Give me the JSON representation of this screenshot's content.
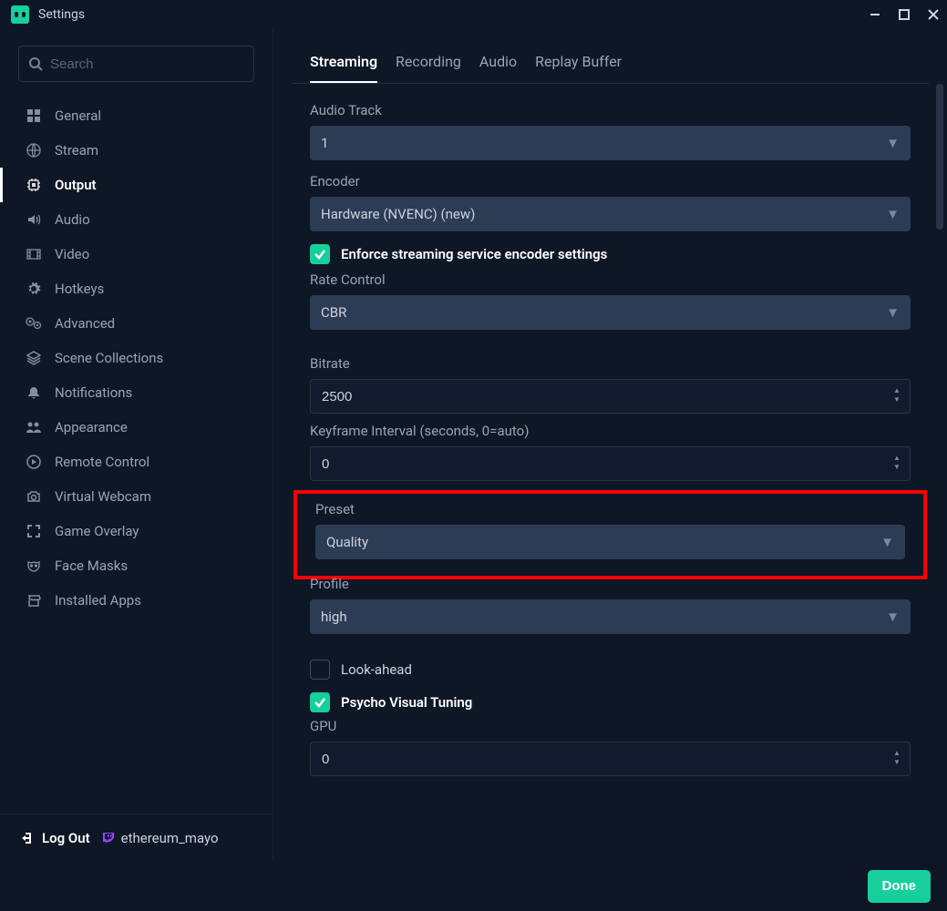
{
  "window": {
    "title": "Settings"
  },
  "search": {
    "placeholder": "Search"
  },
  "sidebar": {
    "items": [
      {
        "label": "General",
        "icon": "grid-icon"
      },
      {
        "label": "Stream",
        "icon": "globe-icon"
      },
      {
        "label": "Output",
        "icon": "chip-icon",
        "active": true
      },
      {
        "label": "Audio",
        "icon": "volume-icon"
      },
      {
        "label": "Video",
        "icon": "film-icon"
      },
      {
        "label": "Hotkeys",
        "icon": "gear-icon"
      },
      {
        "label": "Advanced",
        "icon": "gears-icon"
      },
      {
        "label": "Scene Collections",
        "icon": "layers-icon"
      },
      {
        "label": "Notifications",
        "icon": "bell-icon"
      },
      {
        "label": "Appearance",
        "icon": "persons-icon"
      },
      {
        "label": "Remote Control",
        "icon": "play-circle-icon"
      },
      {
        "label": "Virtual Webcam",
        "icon": "camera-icon"
      },
      {
        "label": "Game Overlay",
        "icon": "expand-icon"
      },
      {
        "label": "Face Masks",
        "icon": "mask-icon"
      },
      {
        "label": "Installed Apps",
        "icon": "store-icon"
      }
    ],
    "logout": "Log Out",
    "user": "ethereum_mayo"
  },
  "tabs": [
    {
      "label": "Streaming",
      "active": true
    },
    {
      "label": "Recording"
    },
    {
      "label": "Audio"
    },
    {
      "label": "Replay Buffer"
    }
  ],
  "form": {
    "audio_track": {
      "label": "Audio Track",
      "value": "1"
    },
    "encoder": {
      "label": "Encoder",
      "value": "Hardware (NVENC) (new)"
    },
    "enforce": {
      "label": "Enforce streaming service encoder settings",
      "checked": true
    },
    "rate_control": {
      "label": "Rate Control",
      "value": "CBR"
    },
    "bitrate": {
      "label": "Bitrate",
      "value": "2500"
    },
    "keyframe": {
      "label": "Keyframe Interval (seconds, 0=auto)",
      "value": "0"
    },
    "preset": {
      "label": "Preset",
      "value": "Quality"
    },
    "profile": {
      "label": "Profile",
      "value": "high"
    },
    "lookahead": {
      "label": "Look-ahead",
      "checked": false
    },
    "psycho": {
      "label": "Psycho Visual Tuning",
      "checked": true
    },
    "gpu": {
      "label": "GPU",
      "value": "0"
    }
  },
  "footer": {
    "done": "Done"
  }
}
